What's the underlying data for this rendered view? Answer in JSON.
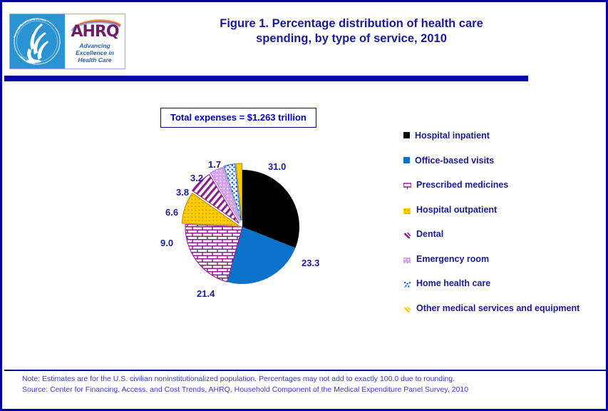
{
  "header": {
    "title": "Figure 1. Percentage distribution of health care spending, by type of service, 2010",
    "title_line1": "Figure 1. Percentage distribution of health care",
    "title_line2": "spending, by type of service, 2010",
    "logo": {
      "agency_wordmark": "AHRQ",
      "tagline_line1": "Advancing",
      "tagline_line2": "Excellence in",
      "tagline_line3": "Health Care",
      "seal_icon": "hhs-eagle-seal-icon",
      "seal_text": "DEPARTMENT OF HEALTH & HUMAN SERVICES  USA"
    }
  },
  "callout": {
    "total_expenses_label": "Total expenses = $1.263 trillion"
  },
  "chart_data": {
    "type": "pie",
    "title": "Figure 1. Percentage distribution of health care spending, by type of service, 2010",
    "subtitle": "Total expenses = $1.263 trillion",
    "unit": "percent",
    "legend_position": "right",
    "start_angle_deg": 0,
    "categories": [
      "Hospital inpatient",
      "Office-based visits",
      "Prescribed medicines",
      "Hospital outpatient",
      "Dental",
      "Emergency room",
      "Home health care",
      "Other medical services and equipment"
    ],
    "values": [
      31.0,
      23.3,
      21.4,
      9.0,
      6.6,
      3.8,
      3.2,
      1.7
    ],
    "labels": [
      "31.0",
      "23.3",
      "21.4",
      "9.0",
      "6.6",
      "3.8",
      "3.2",
      "1.7"
    ],
    "colors": [
      "#000000",
      "#0a72c8",
      "#8e1b8e",
      "#ffcc00",
      "#8e1b8e",
      "#cc99e0",
      "#1a5fd0",
      "#ffcc00"
    ],
    "patterns": [
      "solid",
      "solid",
      "brick",
      "dots",
      "diagonal-stripes",
      "dots",
      "dots",
      "solid"
    ],
    "total": 100.0
  },
  "legend": {
    "items": [
      {
        "label": "Hospital inpatient",
        "key": "black-solid-swatch"
      },
      {
        "label": "Office-based visits",
        "key": "blue-solid-swatch"
      },
      {
        "label": "Prescribed medicines",
        "key": "purple-brick-swatch"
      },
      {
        "label": "Hospital outpatient",
        "key": "yellow-dot-swatch"
      },
      {
        "label": "Dental",
        "key": "purple-diagonal-swatch"
      },
      {
        "label": "Emergency room",
        "key": "violet-dot-swatch"
      },
      {
        "label": "Home health care",
        "key": "blue-dot-swatch"
      },
      {
        "label": "Other medical services and equipment",
        "key": "yellow-diagonal-swatch"
      }
    ]
  },
  "footnote": {
    "note": "Note: Estimates are for the U.S.  civilian noninstitutionalized population. Percentages may not add to  exactly  100.0 due to rounding.",
    "source": "Source: Center for Financing, Access, and Cost Trends, AHRQ,  Household Component of the Medical Expenditure Panel Survey,  2010"
  },
  "colors": {
    "frame_navy": "#0000a0",
    "title_blue": "#1a1a96",
    "label_blue": "#0000b4",
    "footnote_blue": "#3b3bbf",
    "seal_blue": "#2b93d1",
    "ahrq_purple": "#6b1f6b"
  }
}
